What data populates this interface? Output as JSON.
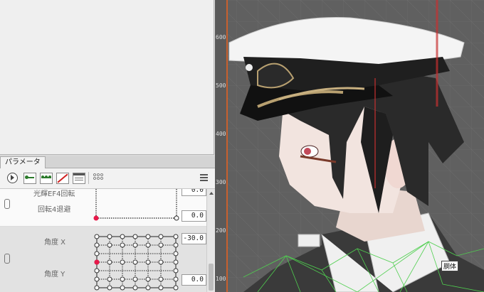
{
  "tab": {
    "label": "パラメータ"
  },
  "toolbar": {
    "icons": [
      "play-circle-icon",
      "add-keyform-icon",
      "add-keyforms-icon",
      "remove-keyform-icon",
      "table-view-icon",
      "grid-view-icon",
      "menu-icon"
    ]
  },
  "params": {
    "rows": [
      {
        "label": "光輝EF4回転",
        "value": "0.0"
      },
      {
        "label": "回転4退避",
        "value": "0.0"
      },
      {
        "label": "角度 X",
        "value": "-30.0"
      },
      {
        "label": "角度 Y",
        "value": "0.0"
      }
    ]
  },
  "ruler": {
    "labels": [
      "600",
      "500",
      "400",
      "300",
      "200",
      "100"
    ]
  },
  "viewport": {
    "body_label": "胴体"
  },
  "colors": {
    "accent": "#e8194a",
    "ruler_border": "#c8602e",
    "mesh": "#4fcf4f"
  }
}
